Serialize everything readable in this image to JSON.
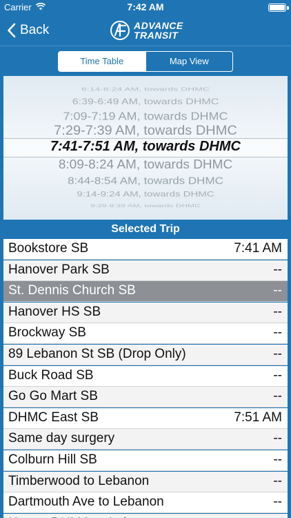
{
  "status_bar": {
    "carrier": "Carrier",
    "time": "7:42 AM",
    "icons": [
      "wifi-icon",
      "battery-icon"
    ]
  },
  "nav": {
    "back_label": "Back",
    "logo_line1": "ADVANCE",
    "logo_line2": "TRANSIT",
    "back_icon": "chevron-left-icon"
  },
  "segments": {
    "timetable": "Time Table",
    "mapview": "Map View",
    "selected": "Time Table"
  },
  "picker": {
    "items": [
      "6:14-6:24 AM, towards DHMC",
      "6:39-6:49 AM, towards DHMC",
      "7:09-7:19 AM, towards DHMC",
      "7:29-7:39 AM, towards DHMC",
      "7:41-7:51 AM, towards DHMC",
      "8:09-8:24 AM, towards DHMC",
      "8:44-8:54 AM, towards DHMC",
      "9:14-9:24 AM, towards DHMC",
      "9:29-9:39 AM, towards DHMC"
    ],
    "selected_index": 4
  },
  "section": {
    "title": "Selected Trip"
  },
  "stops": [
    {
      "name": "Bookstore SB",
      "time": "7:41 AM"
    },
    {
      "name": "Hanover Park SB",
      "time": "--"
    },
    {
      "name": "St. Dennis Church SB",
      "time": "--",
      "selected": true
    },
    {
      "name": "Hanover HS SB",
      "time": "--"
    },
    {
      "name": "Brockway SB",
      "time": "--"
    },
    {
      "name": "89 Lebanon St SB (Drop Only)",
      "time": "--"
    },
    {
      "name": "Buck Road SB",
      "time": "--"
    },
    {
      "name": "Go Go Mart SB",
      "time": "--"
    },
    {
      "name": "DHMC East SB",
      "time": "7:51 AM"
    },
    {
      "name": "Same day surgery",
      "time": "--"
    },
    {
      "name": "Colburn Hill SB",
      "time": "--"
    },
    {
      "name": "Timberwood to Lebanon",
      "time": "--"
    },
    {
      "name": "Dartmouth Ave to Lebanon",
      "time": "--"
    },
    {
      "name": "Heater DHMC to Leb",
      "time": "--"
    }
  ],
  "colors": {
    "brand": "#1f75b3",
    "selected_row": "#8d9095"
  }
}
